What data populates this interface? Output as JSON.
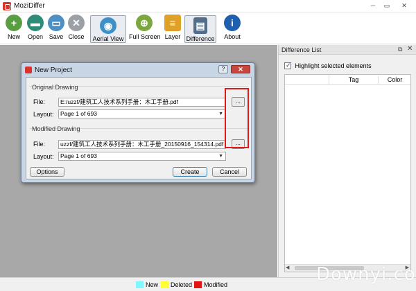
{
  "window": {
    "title": "MoziDiffer",
    "controls": {
      "minimize": "─",
      "maximize": "▭",
      "close": "✕"
    }
  },
  "toolbar": {
    "items": [
      {
        "label": "New",
        "icon": "plus-icon",
        "glyph": "+"
      },
      {
        "label": "Open",
        "icon": "folder-icon",
        "glyph": "▬"
      },
      {
        "label": "Save",
        "icon": "save-icon",
        "glyph": "▭"
      },
      {
        "label": "Close",
        "icon": "close-icon",
        "glyph": "✕"
      },
      {
        "label": "Aerial View",
        "icon": "eye-icon",
        "glyph": "◉"
      },
      {
        "label": "Full Screen",
        "icon": "zoom-icon",
        "glyph": "⊕"
      },
      {
        "label": "Layer",
        "icon": "layers-icon",
        "glyph": "≡"
      },
      {
        "label": "Difference",
        "icon": "difference-icon",
        "glyph": "▤"
      },
      {
        "label": "About",
        "icon": "info-icon",
        "glyph": "i"
      }
    ]
  },
  "dialog": {
    "title": "New Project",
    "help": "?",
    "close": "✕",
    "original": {
      "group_title": "Original Drawing",
      "file_label": "File:",
      "file_value": "E:/uzzf/建筑工人技术系列手册：木工手册.pdf",
      "browse_label": "...",
      "layout_label": "Layout:",
      "layout_value": "Page 1 of 693"
    },
    "modified": {
      "group_title": "Modified Drawing",
      "file_label": "File:",
      "file_value": "uzzf/建筑工人技术系列手册：木工手册_20150916_154314.pdf",
      "browse_label": "...",
      "layout_label": "Layout:",
      "layout_value": "Page 1 of 693"
    },
    "buttons": {
      "options": "Options",
      "create": "Create",
      "cancel": "Cancel"
    }
  },
  "diff_panel": {
    "title": "Difference List",
    "float": "⧉",
    "close": "✕",
    "highlight_label": "Highlight selected elements",
    "highlight_checked": true,
    "columns": [
      "",
      "Tag",
      "Color"
    ]
  },
  "legend": [
    {
      "label": "New",
      "color": "#7ff7ff"
    },
    {
      "label": "Deleted",
      "color": "#ffff33"
    },
    {
      "label": "Modified",
      "color": "#e31414"
    }
  ],
  "watermark": "Downyi.com",
  "highlight_frame_color": "#e01a1a"
}
